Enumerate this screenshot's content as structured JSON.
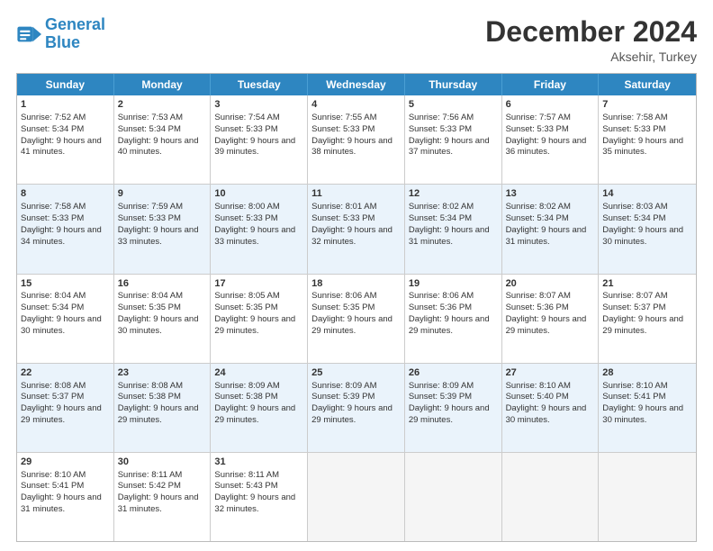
{
  "header": {
    "logo_line1": "General",
    "logo_line2": "Blue",
    "month": "December 2024",
    "location": "Aksehir, Turkey"
  },
  "days_of_week": [
    "Sunday",
    "Monday",
    "Tuesday",
    "Wednesday",
    "Thursday",
    "Friday",
    "Saturday"
  ],
  "rows": [
    {
      "alt": false,
      "cells": [
        {
          "day": "1",
          "rise": "Sunrise: 7:52 AM",
          "set": "Sunset: 5:34 PM",
          "daylight": "Daylight: 9 hours and 41 minutes."
        },
        {
          "day": "2",
          "rise": "Sunrise: 7:53 AM",
          "set": "Sunset: 5:34 PM",
          "daylight": "Daylight: 9 hours and 40 minutes."
        },
        {
          "day": "3",
          "rise": "Sunrise: 7:54 AM",
          "set": "Sunset: 5:33 PM",
          "daylight": "Daylight: 9 hours and 39 minutes."
        },
        {
          "day": "4",
          "rise": "Sunrise: 7:55 AM",
          "set": "Sunset: 5:33 PM",
          "daylight": "Daylight: 9 hours and 38 minutes."
        },
        {
          "day": "5",
          "rise": "Sunrise: 7:56 AM",
          "set": "Sunset: 5:33 PM",
          "daylight": "Daylight: 9 hours and 37 minutes."
        },
        {
          "day": "6",
          "rise": "Sunrise: 7:57 AM",
          "set": "Sunset: 5:33 PM",
          "daylight": "Daylight: 9 hours and 36 minutes."
        },
        {
          "day": "7",
          "rise": "Sunrise: 7:58 AM",
          "set": "Sunset: 5:33 PM",
          "daylight": "Daylight: 9 hours and 35 minutes."
        }
      ]
    },
    {
      "alt": true,
      "cells": [
        {
          "day": "8",
          "rise": "Sunrise: 7:58 AM",
          "set": "Sunset: 5:33 PM",
          "daylight": "Daylight: 9 hours and 34 minutes."
        },
        {
          "day": "9",
          "rise": "Sunrise: 7:59 AM",
          "set": "Sunset: 5:33 PM",
          "daylight": "Daylight: 9 hours and 33 minutes."
        },
        {
          "day": "10",
          "rise": "Sunrise: 8:00 AM",
          "set": "Sunset: 5:33 PM",
          "daylight": "Daylight: 9 hours and 33 minutes."
        },
        {
          "day": "11",
          "rise": "Sunrise: 8:01 AM",
          "set": "Sunset: 5:33 PM",
          "daylight": "Daylight: 9 hours and 32 minutes."
        },
        {
          "day": "12",
          "rise": "Sunrise: 8:02 AM",
          "set": "Sunset: 5:34 PM",
          "daylight": "Daylight: 9 hours and 31 minutes."
        },
        {
          "day": "13",
          "rise": "Sunrise: 8:02 AM",
          "set": "Sunset: 5:34 PM",
          "daylight": "Daylight: 9 hours and 31 minutes."
        },
        {
          "day": "14",
          "rise": "Sunrise: 8:03 AM",
          "set": "Sunset: 5:34 PM",
          "daylight": "Daylight: 9 hours and 30 minutes."
        }
      ]
    },
    {
      "alt": false,
      "cells": [
        {
          "day": "15",
          "rise": "Sunrise: 8:04 AM",
          "set": "Sunset: 5:34 PM",
          "daylight": "Daylight: 9 hours and 30 minutes."
        },
        {
          "day": "16",
          "rise": "Sunrise: 8:04 AM",
          "set": "Sunset: 5:35 PM",
          "daylight": "Daylight: 9 hours and 30 minutes."
        },
        {
          "day": "17",
          "rise": "Sunrise: 8:05 AM",
          "set": "Sunset: 5:35 PM",
          "daylight": "Daylight: 9 hours and 29 minutes."
        },
        {
          "day": "18",
          "rise": "Sunrise: 8:06 AM",
          "set": "Sunset: 5:35 PM",
          "daylight": "Daylight: 9 hours and 29 minutes."
        },
        {
          "day": "19",
          "rise": "Sunrise: 8:06 AM",
          "set": "Sunset: 5:36 PM",
          "daylight": "Daylight: 9 hours and 29 minutes."
        },
        {
          "day": "20",
          "rise": "Sunrise: 8:07 AM",
          "set": "Sunset: 5:36 PM",
          "daylight": "Daylight: 9 hours and 29 minutes."
        },
        {
          "day": "21",
          "rise": "Sunrise: 8:07 AM",
          "set": "Sunset: 5:37 PM",
          "daylight": "Daylight: 9 hours and 29 minutes."
        }
      ]
    },
    {
      "alt": true,
      "cells": [
        {
          "day": "22",
          "rise": "Sunrise: 8:08 AM",
          "set": "Sunset: 5:37 PM",
          "daylight": "Daylight: 9 hours and 29 minutes."
        },
        {
          "day": "23",
          "rise": "Sunrise: 8:08 AM",
          "set": "Sunset: 5:38 PM",
          "daylight": "Daylight: 9 hours and 29 minutes."
        },
        {
          "day": "24",
          "rise": "Sunrise: 8:09 AM",
          "set": "Sunset: 5:38 PM",
          "daylight": "Daylight: 9 hours and 29 minutes."
        },
        {
          "day": "25",
          "rise": "Sunrise: 8:09 AM",
          "set": "Sunset: 5:39 PM",
          "daylight": "Daylight: 9 hours and 29 minutes."
        },
        {
          "day": "26",
          "rise": "Sunrise: 8:09 AM",
          "set": "Sunset: 5:39 PM",
          "daylight": "Daylight: 9 hours and 29 minutes."
        },
        {
          "day": "27",
          "rise": "Sunrise: 8:10 AM",
          "set": "Sunset: 5:40 PM",
          "daylight": "Daylight: 9 hours and 30 minutes."
        },
        {
          "day": "28",
          "rise": "Sunrise: 8:10 AM",
          "set": "Sunset: 5:41 PM",
          "daylight": "Daylight: 9 hours and 30 minutes."
        }
      ]
    },
    {
      "alt": false,
      "cells": [
        {
          "day": "29",
          "rise": "Sunrise: 8:10 AM",
          "set": "Sunset: 5:41 PM",
          "daylight": "Daylight: 9 hours and 31 minutes."
        },
        {
          "day": "30",
          "rise": "Sunrise: 8:11 AM",
          "set": "Sunset: 5:42 PM",
          "daylight": "Daylight: 9 hours and 31 minutes."
        },
        {
          "day": "31",
          "rise": "Sunrise: 8:11 AM",
          "set": "Sunset: 5:43 PM",
          "daylight": "Daylight: 9 hours and 32 minutes."
        },
        {
          "day": "",
          "rise": "",
          "set": "",
          "daylight": ""
        },
        {
          "day": "",
          "rise": "",
          "set": "",
          "daylight": ""
        },
        {
          "day": "",
          "rise": "",
          "set": "",
          "daylight": ""
        },
        {
          "day": "",
          "rise": "",
          "set": "",
          "daylight": ""
        }
      ]
    }
  ]
}
